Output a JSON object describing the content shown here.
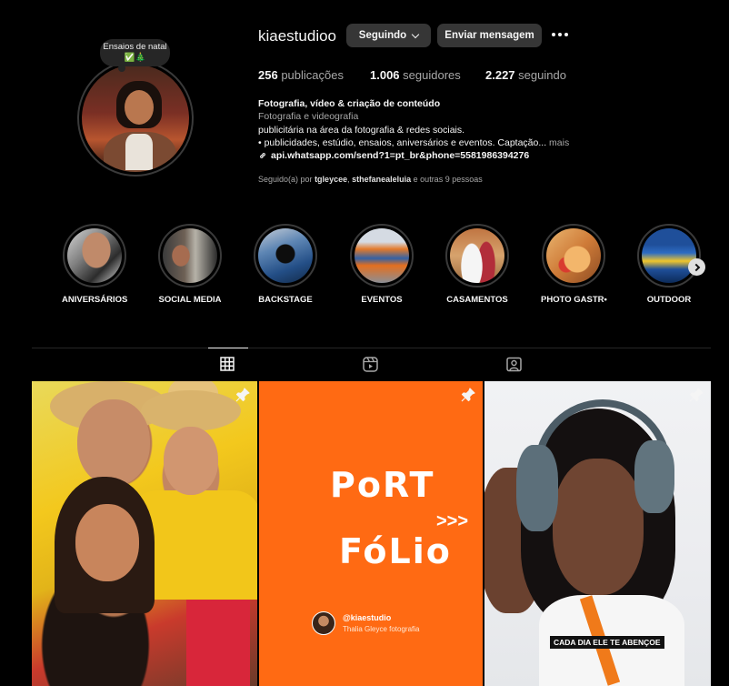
{
  "profile": {
    "username": "kiaestudioo",
    "note": "Ensaios de natal ✅🎄",
    "follow_button": "Seguindo",
    "message_button": "Enviar mensagem",
    "stats": {
      "posts_count": "256",
      "posts_label": "publicações",
      "followers_count": "1.006",
      "followers_label": "seguidores",
      "following_count": "2.227",
      "following_label": "seguindo"
    },
    "bio": {
      "name": "Fotografia, vídeo & criação de conteúdo",
      "category": "Fotografia e videografia",
      "line1": "publicitária na área da fotografia & redes sociais.",
      "line2": "• publicidades, estúdio, ensaios, aniversários e eventos. Captação...",
      "more": "mais",
      "link": "api.whatsapp.com/send?1=pt_br&phone=5581986394276"
    },
    "followed_by": {
      "prefix": "Seguido(a) por",
      "user1": "tgleycee",
      "user2": "sthefanealeluia",
      "suffix": "e outras 9 pessoas"
    }
  },
  "highlights": [
    {
      "label": "ANIVERSÁRIOS"
    },
    {
      "label": "SOCIAL MEDIA"
    },
    {
      "label": "BACKSTAGE"
    },
    {
      "label": "EVENTOS"
    },
    {
      "label": "CASAMENTOS"
    },
    {
      "label": "PHOTO GASTR•"
    },
    {
      "label": "OUTDOOR"
    }
  ],
  "tabs": [
    {
      "icon": "grid-icon",
      "active": true
    },
    {
      "icon": "reels-icon",
      "active": false
    },
    {
      "icon": "tagged-icon",
      "active": false
    }
  ],
  "posts": {
    "post2": {
      "word1": "PoRT",
      "word2": "FóLio",
      "arrows": ">>>",
      "credit_handle": "@kiaestudio",
      "credit_name": "Thalia Gleyce fotografia"
    },
    "post3": {
      "caption": "CADA DIA ELE TE ABENÇOE"
    }
  },
  "colors": {
    "background": "#000000",
    "button": "#363636",
    "portfolio_orange": "#ff6a13",
    "muted_text": "#a8a8a8"
  }
}
